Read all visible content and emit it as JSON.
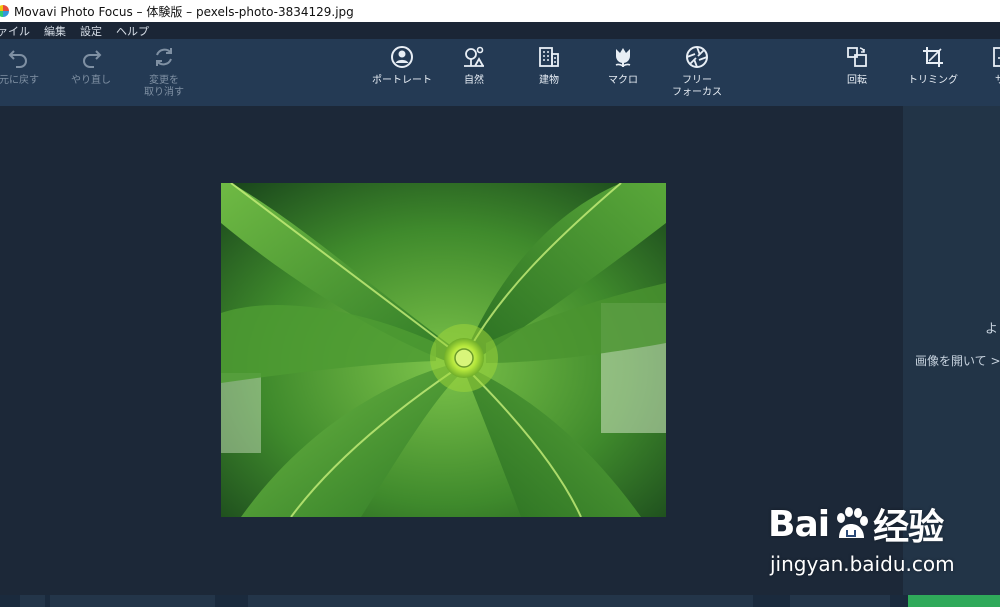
{
  "window": {
    "title": "Movavi Photo Focus – 体験版 – pexels-photo-3834129.jpg"
  },
  "menu": [
    "ァイル",
    "編集",
    "設定",
    "ヘルプ"
  ],
  "toolbar": {
    "undo": "元に戻す",
    "redo": "やり直し",
    "reset_line1": "変更を",
    "reset_line2": "取り消す",
    "portrait": "ポートレート",
    "nature": "自然",
    "architecture": "建物",
    "macro": "マクロ",
    "free_line1": "フリー",
    "free_line2": "フォーカス",
    "rotate": "回転",
    "trim": "トリミング",
    "cut_off": "サ"
  },
  "side_panel": {
    "line1": "よ",
    "line2": "画像を開いて >"
  },
  "watermark": {
    "brand_left": "Bai",
    "brand_right": "经验",
    "url": "jingyan.baidu.com"
  },
  "colors": {
    "toolbar": "#243a54",
    "canvas": "#1c2838",
    "accent_green": "#2faa5a"
  }
}
